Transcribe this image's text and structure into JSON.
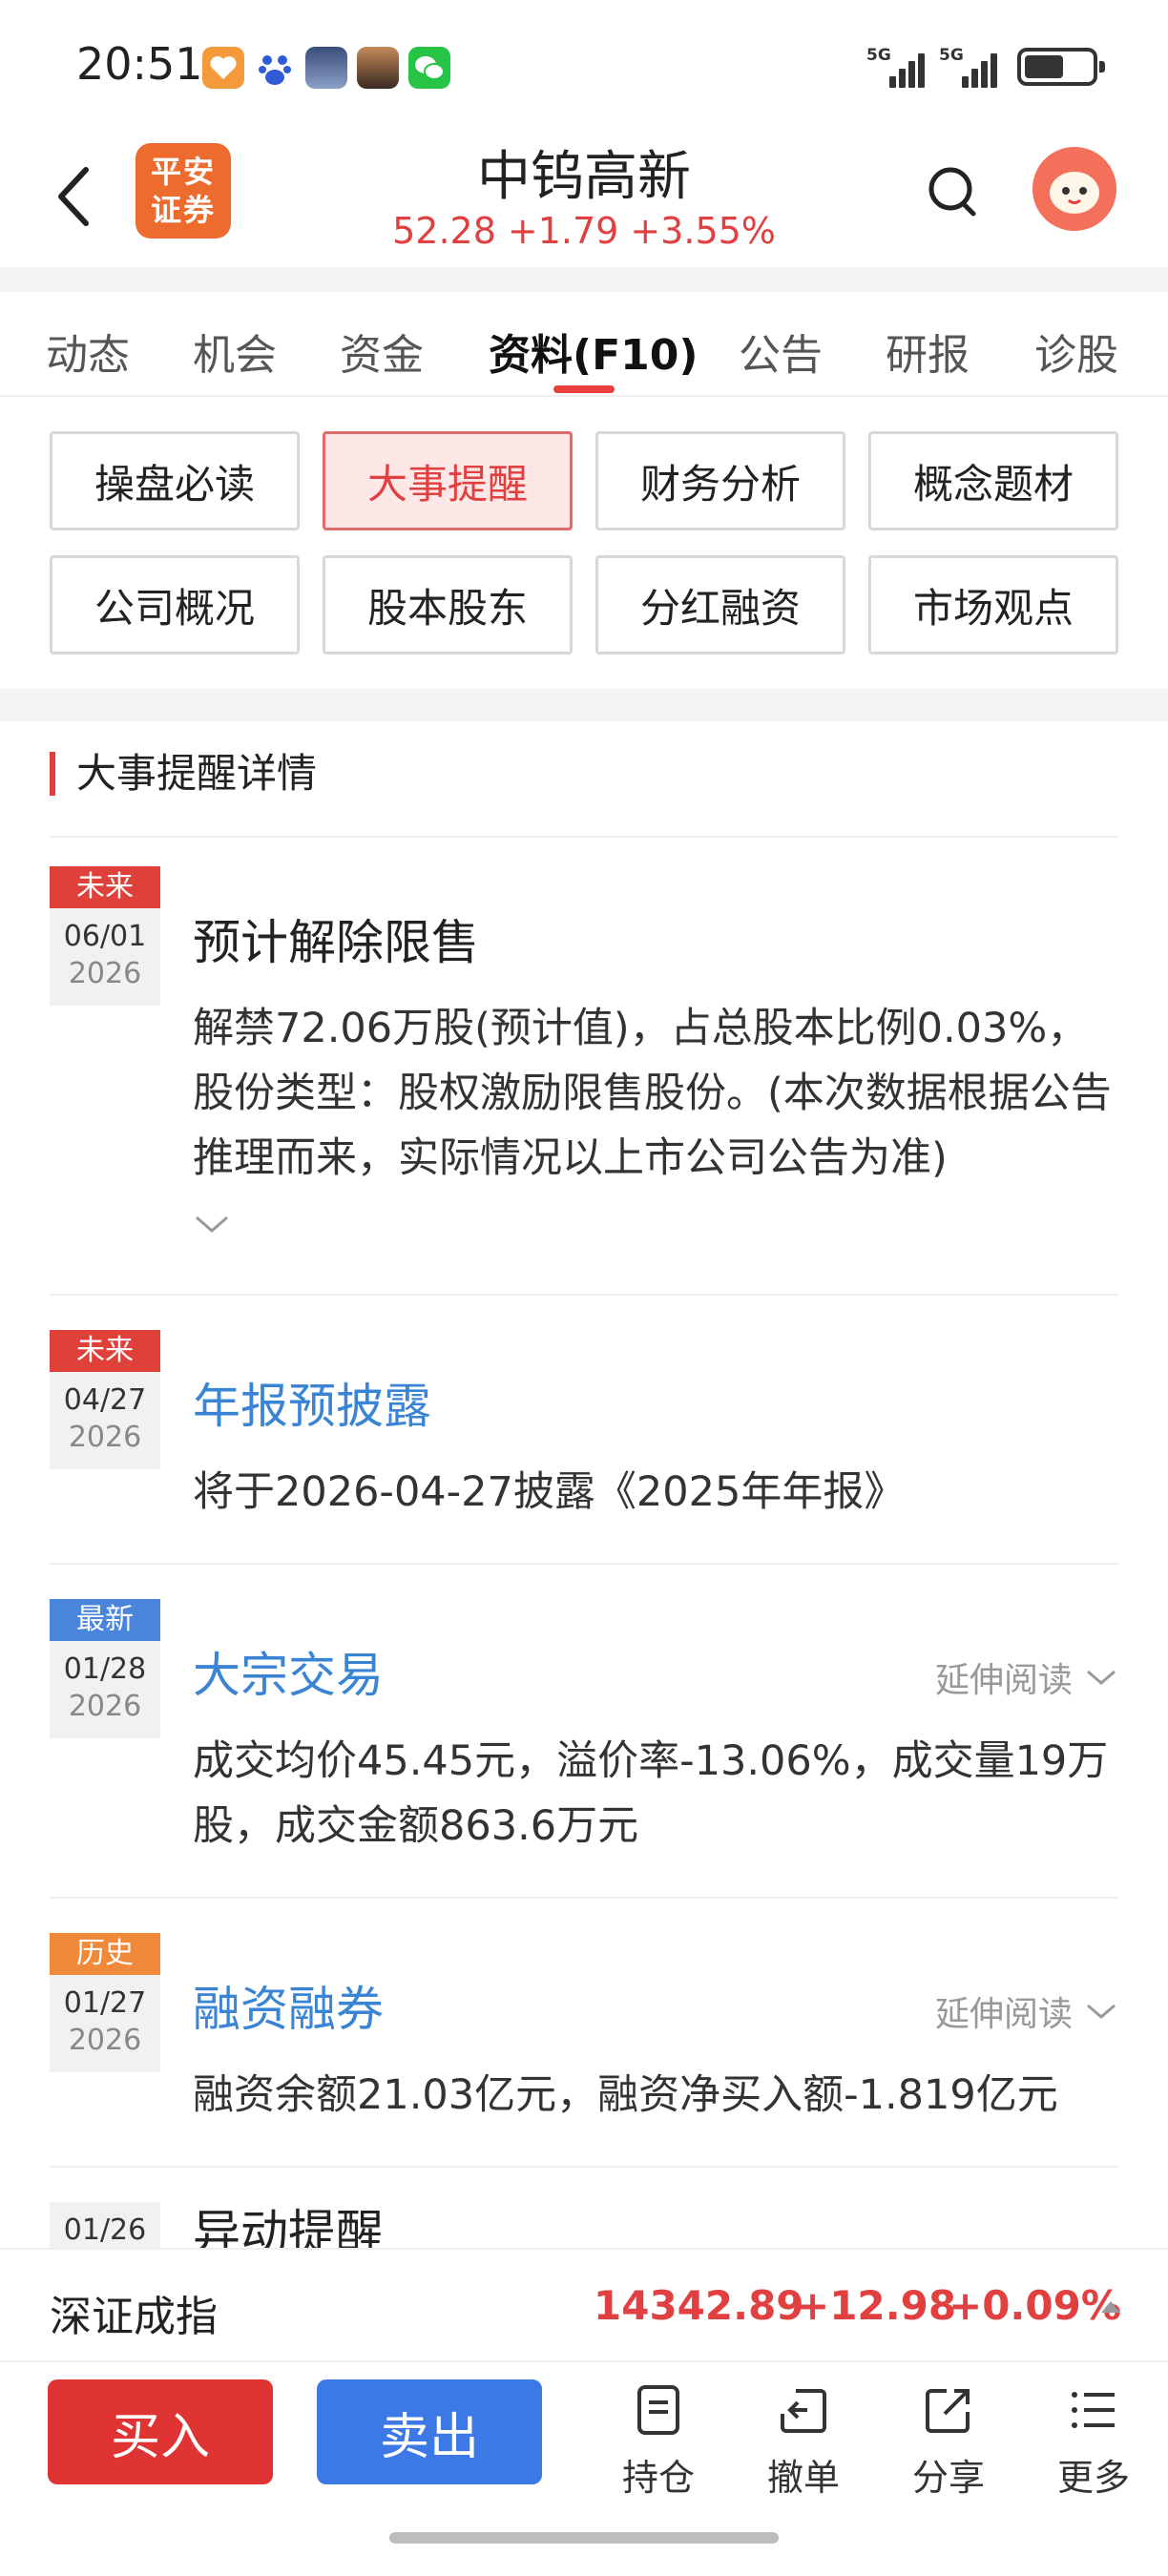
{
  "status_bar": {
    "time": "20:51",
    "network1": "5G",
    "network2": "5G",
    "app_icons": [
      "orange-heart-icon",
      "baidu-paw-icon",
      "city-photo-icon",
      "photo-icon",
      "wechat-icon"
    ]
  },
  "header": {
    "title": "中钨高新",
    "price": "52.28",
    "change": "+1.79",
    "change_pct": "+3.55%",
    "logo_line1": "平安",
    "logo_line2": "证券"
  },
  "tabs": [
    {
      "label": "动态"
    },
    {
      "label": "机会"
    },
    {
      "label": "资金"
    },
    {
      "label": "资料(F10)",
      "active": true
    },
    {
      "label": "公告"
    },
    {
      "label": "研报"
    },
    {
      "label": "诊股"
    }
  ],
  "grid_buttons": [
    {
      "label": "操盘必读"
    },
    {
      "label": "大事提醒",
      "active": true
    },
    {
      "label": "财务分析"
    },
    {
      "label": "概念题材"
    },
    {
      "label": "公司概况"
    },
    {
      "label": "股本股东"
    },
    {
      "label": "分红融资"
    },
    {
      "label": "市场观点"
    }
  ],
  "section_title": "大事提醒详情",
  "events": [
    {
      "tag": "未来",
      "tag_color": "#e0403a",
      "md": "06/01",
      "year": "2026",
      "title": "预计解除限售",
      "body": "解禁72.06万股(预计值)，占总股本比例0.03%，股份类型：股权激励限售股份。(本次数据根据公告推理而来，实际情况以上市公司公告为准)"
    },
    {
      "tag": "未来",
      "tag_color": "#e0403a",
      "md": "04/27",
      "year": "2026",
      "title": "年报预披露",
      "body": "将于2026-04-27披露《2025年年报》"
    },
    {
      "tag": "最新",
      "tag_color": "#4a85dc",
      "md": "01/28",
      "year": "2026",
      "title": "大宗交易",
      "more": "延伸阅读",
      "body": "成交均价45.45元，溢价率-13.06%，成交量19万股，成交金额863.6万元"
    },
    {
      "tag": "历史",
      "tag_color": "#f08a3a",
      "md": "01/27",
      "year": "2026",
      "title": "融资融券",
      "more": "延伸阅读",
      "body": "融资余额21.03亿元，融资净买入额-1.819亿元"
    },
    {
      "md": "01/26",
      "title": "异动提醒"
    }
  ],
  "index_bar": {
    "name": "深证成指",
    "value": "14342.89",
    "change": "+12.98",
    "change_pct": "+0.09%"
  },
  "bottom_bar": {
    "buy": "买入",
    "sell": "卖出",
    "actions": [
      {
        "label": "持仓",
        "icon": "holdings-icon"
      },
      {
        "label": "撤单",
        "icon": "cancel-order-icon"
      },
      {
        "label": "分享",
        "icon": "share-icon"
      },
      {
        "label": "更多",
        "icon": "more-icon"
      }
    ]
  },
  "colors": {
    "red": "#e04040",
    "blue": "#3a84d6",
    "buy": "#df3433",
    "sell": "#3c78e6"
  }
}
